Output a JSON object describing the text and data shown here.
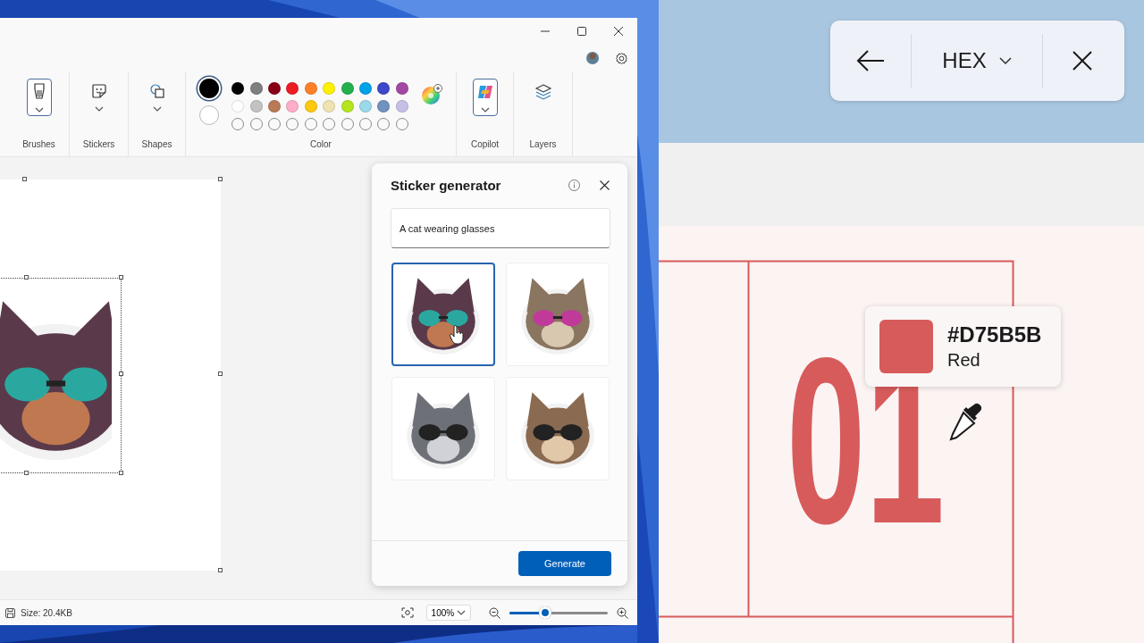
{
  "desktop": {
    "wallpaper": {
      "kind": "picture"
    }
  },
  "paint": {
    "toolbar": [
      {
        "kind": "brushes",
        "label": "Brushes",
        "active": true,
        "has_menu": true
      },
      {
        "kind": "stickers",
        "label": "Stickers",
        "active": false,
        "has_menu": true
      },
      {
        "kind": "shapes",
        "label": "Shapes",
        "active": false,
        "has_menu": true
      },
      {
        "kind": "color",
        "label": "Color",
        "primary": {
          "color": "#000000",
          "selected": true
        },
        "secondary": {
          "color": "#ffffff",
          "selected": false
        },
        "swatches": [
          {
            "color": "#000000"
          },
          {
            "color": "#7f7f7f"
          },
          {
            "color": "#880015"
          },
          {
            "color": "#ed1c24"
          },
          {
            "color": "#ff7f27"
          },
          {
            "color": "#fff200"
          },
          {
            "color": "#22b14c"
          },
          {
            "color": "#00a2e8"
          },
          {
            "color": "#3f48cc"
          },
          {
            "color": "#a349a4"
          },
          {
            "color": "#ffffff"
          },
          {
            "color": "#c3c3c3"
          },
          {
            "color": "#b97a57"
          },
          {
            "color": "#ffaec9"
          },
          {
            "color": "#ffc90e"
          },
          {
            "color": "#efe4b0"
          },
          {
            "color": "#b5e61d"
          },
          {
            "color": "#99d9ea"
          },
          {
            "color": "#7092be"
          },
          {
            "color": "#c8bfe7"
          }
        ]
      },
      {
        "kind": "copilot",
        "label": "Copilot",
        "active": true,
        "has_menu": true
      },
      {
        "kind": "layers",
        "label": "Layers",
        "active": false,
        "has_menu": false
      }
    ],
    "canvas": {
      "sticker": {
        "kind": "picture"
      }
    },
    "sticker_panel": {
      "title": "Sticker generator",
      "prompt": "A cat wearing glasses",
      "results": [
        {
          "kind": "picture",
          "selected": true
        },
        {
          "kind": "picture",
          "selected": false
        },
        {
          "kind": "picture",
          "selected": false
        },
        {
          "kind": "picture",
          "selected": false
        }
      ],
      "button": "Generate"
    },
    "status_bar": {
      "size": "Size: 20.4KB",
      "zoom": "100%",
      "zoom_slider": {
        "level": 0.36
      }
    }
  },
  "right_screen": {
    "color_picker": {
      "format": "HEX"
    },
    "slide": {
      "number": "01"
    },
    "tooltip": {
      "color": "#d75b5b",
      "hex": "#D75B5B",
      "name": "Red"
    }
  }
}
